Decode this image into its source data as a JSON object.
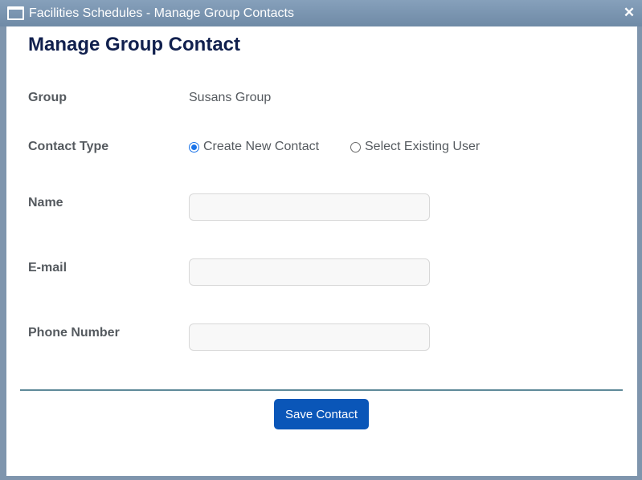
{
  "window": {
    "title": "Facilities Schedules - Manage Group Contacts",
    "close_glyph": "✕"
  },
  "page": {
    "heading": "Manage Group Contact"
  },
  "form": {
    "group": {
      "label": "Group",
      "value": "Susans Group"
    },
    "contact_type": {
      "label": "Contact Type",
      "options": [
        {
          "label": "Create New Contact",
          "selected": true
        },
        {
          "label": "Select Existing User",
          "selected": false
        }
      ]
    },
    "name": {
      "label": "Name",
      "value": "",
      "placeholder": ""
    },
    "email": {
      "label": "E-mail",
      "value": "",
      "placeholder": ""
    },
    "phone": {
      "label": "Phone Number",
      "value": "",
      "placeholder": ""
    }
  },
  "actions": {
    "save_label": "Save Contact"
  },
  "icons": {
    "window": "window-icon",
    "close": "close-icon"
  },
  "colors": {
    "titlebar": "#7b93ad",
    "heading": "#11204e",
    "accent": "#0a56b8",
    "divider": "#5f8a99"
  }
}
